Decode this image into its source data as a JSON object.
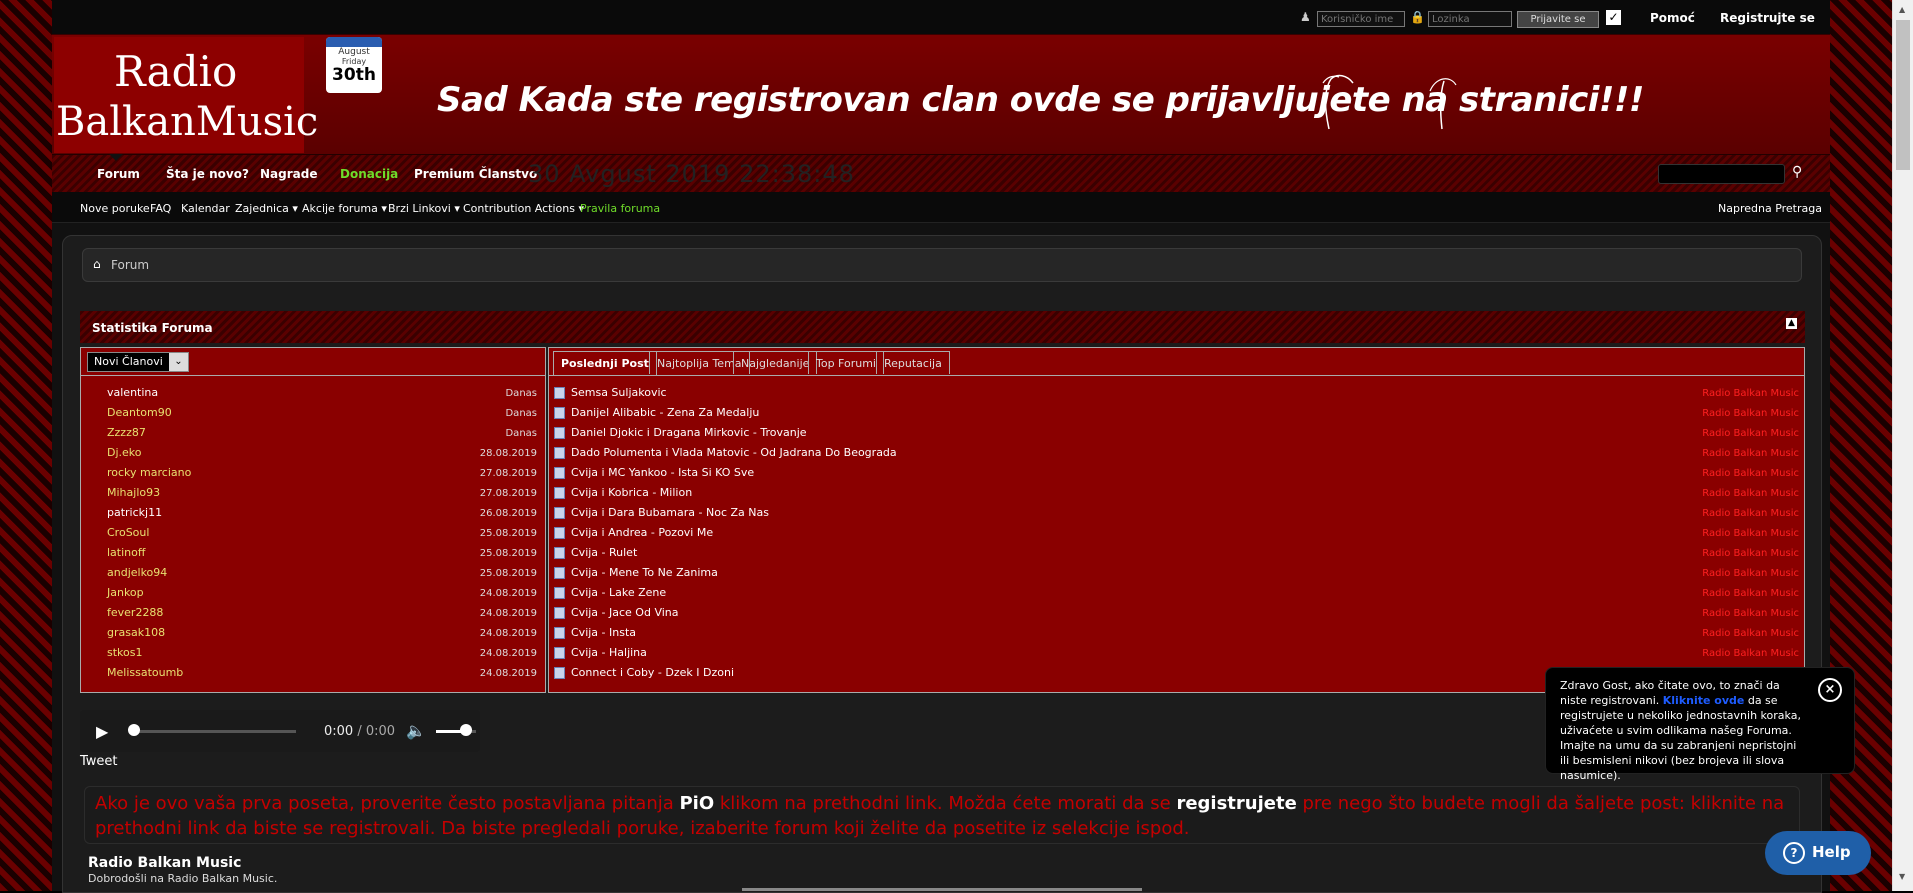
{
  "topbar": {
    "username_placeholder": "Korisničko ime",
    "password_placeholder": "Lozinka",
    "login_button": "Prijavite se",
    "help_link": "Pomoć",
    "register_link": "Registrujte se"
  },
  "header": {
    "logo_line1": "Radio",
    "logo_line2": "BalkanMusic",
    "calendar": {
      "month": "August",
      "day": "Friday",
      "date": "30th"
    },
    "banner_text": "Sad Kada ste registrovan clan ovde se prijavljujete na stranici!!!"
  },
  "mainnav": {
    "items": [
      {
        "label": "Forum"
      },
      {
        "label": "Šta je novo?"
      },
      {
        "label": "Nagrade"
      },
      {
        "label": "Donacija"
      },
      {
        "label": "Premium Članstvo"
      }
    ],
    "date_display": "30 Avgust 2019 22:38:48"
  },
  "subnav": {
    "items": [
      {
        "label": "Nove poruke"
      },
      {
        "label": "FAQ"
      },
      {
        "label": "Kalendar"
      },
      {
        "label": "Zajednica ▾"
      },
      {
        "label": "Akcije foruma ▾"
      },
      {
        "label": "Brzi Linkovi ▾"
      },
      {
        "label": "Contribution Actions ▾"
      },
      {
        "label": "Pravila foruma"
      }
    ],
    "advanced_search": "Napredna Pretraga"
  },
  "breadcrumb": {
    "label": "Forum"
  },
  "stats": {
    "title": "Statistika Foruma",
    "member_select": "Novi Članovi",
    "members": [
      {
        "name": "valentina",
        "date": "Danas",
        "color": "#ffffff"
      },
      {
        "name": "Deantom90",
        "date": "Danas",
        "color": "#e8e070"
      },
      {
        "name": "Zzzz87",
        "date": "Danas",
        "color": "#e8e070"
      },
      {
        "name": "Dj.eko",
        "date": "28.08.2019",
        "color": "#e8e070"
      },
      {
        "name": "rocky marciano",
        "date": "27.08.2019",
        "color": "#e8e070"
      },
      {
        "name": "Mihajlo93",
        "date": "27.08.2019",
        "color": "#e8e070"
      },
      {
        "name": "patrickj11",
        "date": "26.08.2019",
        "color": "#ffffff"
      },
      {
        "name": "CroSoul",
        "date": "25.08.2019",
        "color": "#e8e070"
      },
      {
        "name": "latinoff",
        "date": "25.08.2019",
        "color": "#e8e070"
      },
      {
        "name": "andjelko94",
        "date": "25.08.2019",
        "color": "#e8e070"
      },
      {
        "name": "Jankop",
        "date": "24.08.2019",
        "color": "#e8e070"
      },
      {
        "name": "fever2288",
        "date": "24.08.2019",
        "color": "#e8e070"
      },
      {
        "name": "grasak108",
        "date": "24.08.2019",
        "color": "#e8e070"
      },
      {
        "name": "stkos1",
        "date": "24.08.2019",
        "color": "#e8e070"
      },
      {
        "name": "Melissatoumb",
        "date": "24.08.2019",
        "color": "#e8e070"
      }
    ],
    "tabs": [
      {
        "label": "Poslednji Post",
        "active": true
      },
      {
        "label": "Najtoplija Tema",
        "active": false
      },
      {
        "label": "Najgledanije",
        "active": false
      },
      {
        "label": "Top Forumi",
        "active": false
      },
      {
        "label": "Reputacija",
        "active": false
      }
    ],
    "posts": [
      {
        "title": "Semsa Suljakovic",
        "forum": "Radio Balkan Music"
      },
      {
        "title": "Danijel Alibabic - Zena Za Medalju",
        "forum": "Radio Balkan Music"
      },
      {
        "title": "Daniel Djokic i Dragana Mirkovic - Trovanje",
        "forum": "Radio Balkan Music"
      },
      {
        "title": "Dado Polumenta i Vlada Matovic - Od Jadrana Do Beograda",
        "forum": "Radio Balkan Music"
      },
      {
        "title": "Cvija i MC Yankoo - Ista Si KO Sve",
        "forum": "Radio Balkan Music"
      },
      {
        "title": "Cvija i Kobrica - Milion",
        "forum": "Radio Balkan Music"
      },
      {
        "title": "Cvija i Dara Bubamara - Noc Za Nas",
        "forum": "Radio Balkan Music"
      },
      {
        "title": "Cvija i Andrea - Pozovi Me",
        "forum": "Radio Balkan Music"
      },
      {
        "title": "Cvija - Rulet",
        "forum": "Radio Balkan Music"
      },
      {
        "title": "Cvija - Mene To Ne Zanima",
        "forum": "Radio Balkan Music"
      },
      {
        "title": "Cvija - Lake Zene",
        "forum": "Radio Balkan Music"
      },
      {
        "title": "Cvija - Jace Od Vina",
        "forum": "Radio Balkan Music"
      },
      {
        "title": "Cvija - Insta",
        "forum": "Radio Balkan Music"
      },
      {
        "title": "Cvija - Haljina",
        "forum": "Radio Balkan Music"
      },
      {
        "title": "Connect i Coby - Dzek I Dzoni",
        "forum": ""
      }
    ]
  },
  "audio": {
    "current_time": "0:00",
    "total_time": "/ 0:00",
    "progress": 0,
    "volume": 0.75
  },
  "tweet": "Tweet",
  "notice": {
    "part1": "Ako je ovo vaša prva poseta, proverite često postavljana pitanja ",
    "faq_link": "PiO",
    "part2": " klikom na prethodni link. Možda ćete morati da se ",
    "register_link": "registrujete",
    "part3": " pre nego što budete mogli da šaljete post: kliknite na prethodni link da biste se registrovali. Da biste pregledali poruke, izaberite forum koji želite da posetite iz selekcije ispod."
  },
  "forum_section": {
    "title": "Radio Balkan Music",
    "description": "Dobrodošli na Radio Balkan Music."
  },
  "guest_popup": {
    "text1": "Zdravo Gost, ako čitate ovo, to znači da niste registrovani. ",
    "link": "Kliknite ovde",
    "text2": " da se registrujete u nekoliko jednostavnih koraka, uživaćete u svim odlikama našeg Foruma. Imajte na umu da su zabranjeni nepristojni ili besmisleni nikovi (bez brojeva ili slova nasumice)."
  },
  "help_button": "Help",
  "colors": {
    "accent_red": "#8a0000",
    "link_green": "#6fdc2a",
    "forum_red": "#ff2020",
    "help_blue": "#1f5fa8"
  }
}
